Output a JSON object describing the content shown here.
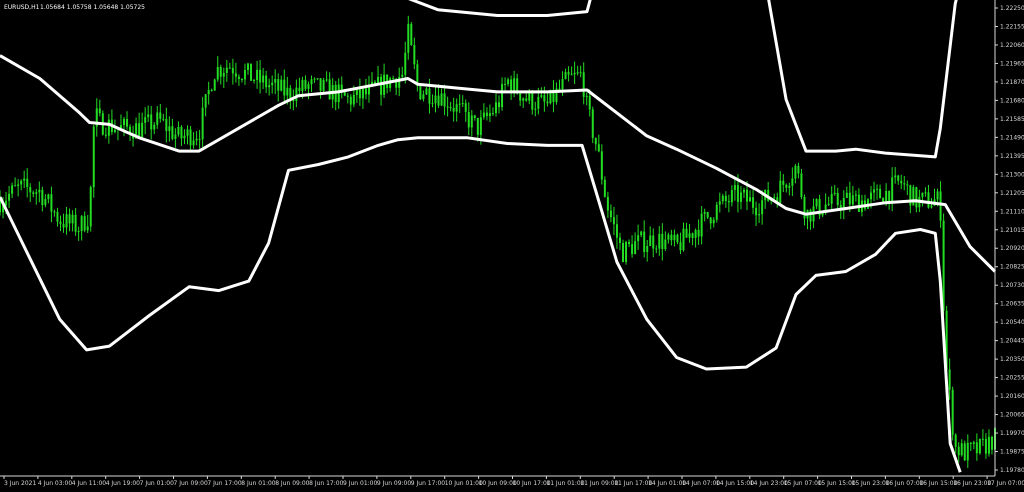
{
  "header": {
    "symbol": "EURUSD,H1",
    "ohlc": "1.05684 1.05758 1.05648 1.05725"
  },
  "colors": {
    "background": "#000000",
    "candle": "#22dd22",
    "band": "#ffffff",
    "axis": "#d8d8d8"
  },
  "chart_data": {
    "type": "candlestick",
    "title": "EURUSD,H1",
    "ylim": [
      1.1978,
      1.2225
    ],
    "y_ticks": [
      "1.22250",
      "1.22155",
      "1.22060",
      "1.21965",
      "1.21870",
      "1.21680",
      "1.21585",
      "1.21490",
      "1.21395",
      "1.21300",
      "1.21205",
      "1.21110",
      "1.21015",
      "1.20920",
      "1.20825",
      "1.20730",
      "1.20635",
      "1.20540",
      "1.20445",
      "1.20350",
      "1.20255",
      "1.20160",
      "1.20065",
      "1.19970",
      "1.19875",
      "1.19780"
    ],
    "x_ticks": [
      "3 Jun 2021",
      "4 Jun 03:00",
      "4 Jun 11:00",
      "4 Jun 19:00",
      "7 Jun 01:00",
      "7 Jun 09:00",
      "7 Jun 17:00",
      "8 Jun 01:00",
      "8 Jun 09:00",
      "8 Jun 17:00",
      "9 Jun 01:00",
      "9 Jun 09:00",
      "9 Jun 17:00",
      "10 Jun 01:00",
      "10 Jun 09:00",
      "10 Jun 17:00",
      "11 Jun 01:00",
      "11 Jun 09:00",
      "11 Jun 17:00",
      "14 Jun 01:00",
      "14 Jun 07:00",
      "14 Jun 15:00",
      "14 Jun 23:00",
      "15 Jun 07:00",
      "15 Jun 15:00",
      "15 Jun 23:00",
      "16 Jun 07:00",
      "16 Jun 15:00",
      "16 Jun 23:00",
      "17 Jun 07:00"
    ],
    "price_path": [
      [
        0,
        1.2122
      ],
      [
        0.02,
        1.2129
      ],
      [
        0.04,
        1.2127
      ],
      [
        0.06,
        1.2112
      ],
      [
        0.08,
        1.2108
      ],
      [
        0.09,
        1.2115
      ],
      [
        0.095,
        1.2168
      ],
      [
        0.1,
        1.2163
      ],
      [
        0.12,
        1.216
      ],
      [
        0.14,
        1.216
      ],
      [
        0.16,
        1.2164
      ],
      [
        0.18,
        1.2155
      ],
      [
        0.2,
        1.2158
      ],
      [
        0.215,
        1.219
      ],
      [
        0.23,
        1.2193
      ],
      [
        0.26,
        1.2185
      ],
      [
        0.29,
        1.2178
      ],
      [
        0.31,
        1.2182
      ],
      [
        0.33,
        1.218
      ],
      [
        0.35,
        1.2175
      ],
      [
        0.37,
        1.2178
      ],
      [
        0.39,
        1.2185
      ],
      [
        0.405,
        1.2188
      ],
      [
        0.41,
        1.221
      ],
      [
        0.42,
        1.218
      ],
      [
        0.44,
        1.2178
      ],
      [
        0.46,
        1.217
      ],
      [
        0.48,
        1.216
      ],
      [
        0.5,
        1.2172
      ],
      [
        0.51,
        1.2185
      ],
      [
        0.53,
        1.2175
      ],
      [
        0.55,
        1.2172
      ],
      [
        0.57,
        1.2185
      ],
      [
        0.585,
        1.2188
      ],
      [
        0.59,
        1.217
      ],
      [
        0.6,
        1.215
      ],
      [
        0.61,
        1.212
      ],
      [
        0.625,
        1.2095
      ],
      [
        0.64,
        1.21
      ],
      [
        0.66,
        1.2102
      ],
      [
        0.68,
        1.2098
      ],
      [
        0.7,
        1.2108
      ],
      [
        0.72,
        1.2118
      ],
      [
        0.74,
        1.2125
      ],
      [
        0.76,
        1.212
      ],
      [
        0.78,
        1.2126
      ],
      [
        0.8,
        1.214
      ],
      [
        0.81,
        1.2115
      ],
      [
        0.83,
        1.212
      ],
      [
        0.85,
        1.2122
      ],
      [
        0.87,
        1.2122
      ],
      [
        0.89,
        1.2126
      ],
      [
        0.905,
        1.2132
      ],
      [
        0.92,
        1.2122
      ],
      [
        0.945,
        1.2122
      ],
      [
        0.95,
        1.204
      ],
      [
        0.96,
        1.1993
      ],
      [
        0.97,
        1.199
      ],
      [
        0.985,
        1.1992
      ],
      [
        1.0,
        1.1998
      ]
    ],
    "upper_band": [
      [
        0,
        1.2198
      ],
      [
        0.04,
        1.2186
      ],
      [
        0.08,
        1.2168
      ],
      [
        0.09,
        1.2163
      ],
      [
        0.11,
        1.2162
      ],
      [
        0.14,
        1.2155
      ],
      [
        0.18,
        1.2148
      ],
      [
        0.2,
        1.2148
      ],
      [
        0.24,
        1.216
      ],
      [
        0.28,
        1.2172
      ],
      [
        0.3,
        1.2177
      ],
      [
        0.34,
        1.2179
      ],
      [
        0.37,
        1.2182
      ],
      [
        0.41,
        1.2186
      ],
      [
        0.42,
        1.2183
      ],
      [
        0.46,
        1.2181
      ],
      [
        0.5,
        1.2179
      ],
      [
        0.55,
        1.2179
      ],
      [
        0.59,
        1.218
      ],
      [
        0.62,
        1.2168
      ],
      [
        0.65,
        1.2156
      ],
      [
        0.68,
        1.2149
      ],
      [
        0.72,
        1.2139
      ],
      [
        0.76,
        1.2128
      ],
      [
        0.79,
        1.2118
      ],
      [
        0.81,
        1.2115
      ],
      [
        0.85,
        1.2118
      ],
      [
        0.89,
        1.2121
      ],
      [
        0.92,
        1.2122
      ],
      [
        0.95,
        1.212
      ],
      [
        0.975,
        1.2098
      ],
      [
        1.0,
        1.2085
      ]
    ],
    "outer_upper_band": [
      [
        0.15,
        1.226
      ],
      [
        0.18,
        1.2238
      ],
      [
        0.19,
        1.223
      ],
      [
        0.21,
        1.224
      ],
      [
        0.24,
        1.2256
      ],
      [
        0.27,
        1.226
      ],
      [
        0.29,
        1.223
      ],
      [
        0.32,
        1.2231
      ],
      [
        0.37,
        1.223
      ],
      [
        0.41,
        1.2228
      ],
      [
        0.44,
        1.2222
      ],
      [
        0.5,
        1.2219
      ],
      [
        0.55,
        1.2219
      ],
      [
        0.59,
        1.2221
      ],
      [
        0.61,
        1.226
      ],
      [
        0.73,
        1.2262
      ],
      [
        0.77,
        1.2235
      ],
      [
        0.79,
        1.2175
      ],
      [
        0.81,
        1.2148
      ],
      [
        0.84,
        1.2148
      ],
      [
        0.86,
        1.2149
      ],
      [
        0.89,
        1.2147
      ],
      [
        0.94,
        1.2145
      ],
      [
        0.945,
        1.216
      ],
      [
        0.96,
        1.2225
      ],
      [
        0.975,
        1.2258
      ]
    ],
    "lower_band": [
      [
        0,
        1.2124
      ],
      [
        0.03,
        1.2092
      ],
      [
        0.06,
        1.206
      ],
      [
        0.087,
        1.2044
      ],
      [
        0.11,
        1.2046
      ],
      [
        0.15,
        1.2062
      ],
      [
        0.19,
        1.2077
      ],
      [
        0.22,
        1.2075
      ],
      [
        0.25,
        1.208
      ],
      [
        0.27,
        1.21
      ],
      [
        0.29,
        1.2138
      ],
      [
        0.32,
        1.2141
      ],
      [
        0.35,
        1.2145
      ],
      [
        0.38,
        1.2151
      ],
      [
        0.4,
        1.2154
      ],
      [
        0.42,
        1.2155
      ],
      [
        0.47,
        1.2155
      ],
      [
        0.51,
        1.2152
      ],
      [
        0.55,
        1.2151
      ],
      [
        0.585,
        1.2151
      ],
      [
        0.6,
        1.2125
      ],
      [
        0.62,
        1.209
      ],
      [
        0.65,
        1.206
      ],
      [
        0.68,
        1.204
      ],
      [
        0.71,
        1.2034
      ],
      [
        0.75,
        1.2035
      ],
      [
        0.78,
        1.2045
      ],
      [
        0.8,
        1.2073
      ],
      [
        0.82,
        1.2083
      ],
      [
        0.85,
        1.2085
      ],
      [
        0.88,
        1.2094
      ],
      [
        0.9,
        1.2105
      ],
      [
        0.925,
        1.2107
      ],
      [
        0.94,
        1.2105
      ],
      [
        0.945,
        1.208
      ],
      [
        0.955,
        1.1995
      ],
      [
        0.965,
        1.198
      ]
    ]
  }
}
